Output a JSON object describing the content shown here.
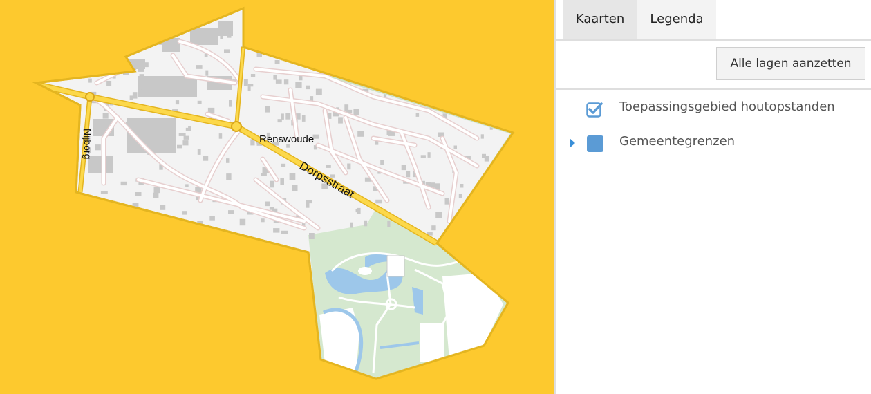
{
  "map": {
    "labels": {
      "place": "Renswoude",
      "street_main": "Dorpsstraat",
      "street_side": "Nijborg"
    },
    "colors": {
      "background": "#FDC92E",
      "area": "#F3F3F3",
      "boundary": "#E4B520",
      "road_main": "#FCD84A",
      "road": "#FFFFFF",
      "road_edge": "#E7CFCF",
      "buildings": "#C8C8C8",
      "park": "#D5E8CF",
      "water": "#9DC7EA"
    }
  },
  "tabs": [
    {
      "label": "Kaarten",
      "active": true
    },
    {
      "label": "Legenda",
      "active": false
    }
  ],
  "toolbar": {
    "all_layers_label": "Alle lagen aanzetten"
  },
  "layers": [
    {
      "label": "Toepassingsgebied houtopstanden",
      "checked": true,
      "icon": "checkbox-checked-icon"
    },
    {
      "label": "Gemeentegrenzen",
      "checked": false,
      "icon": "layer-color-square-icon",
      "color": "#5B9BD5"
    }
  ]
}
